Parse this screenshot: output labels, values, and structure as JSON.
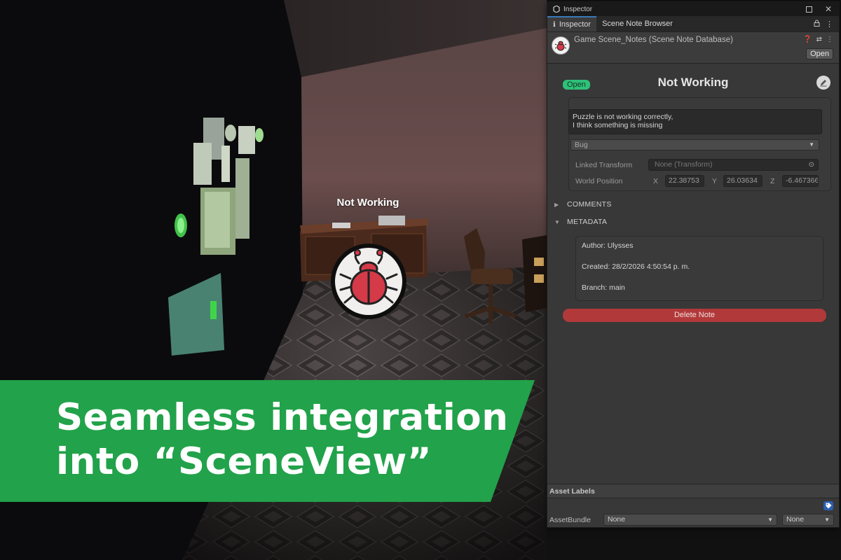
{
  "scene": {
    "note_label": "Not Working"
  },
  "banner": {
    "line1": "Seamless integration",
    "line2": "into “SceneView”",
    "color": "#22a24a"
  },
  "inspector": {
    "window_title": "Inspector",
    "tabs": [
      {
        "label": "Inspector",
        "active": true
      },
      {
        "label": "Scene Note Browser",
        "active": false
      }
    ],
    "asset_title": "Game Scene_Notes (Scene Note Database)",
    "open_button": "Open",
    "note": {
      "status": "Open",
      "status_color": "#2fc07a",
      "title": "Not Working",
      "description_line1": "Puzzle is not working correctly,",
      "description_line2": "I think something is missing",
      "type": "Bug",
      "linked_transform_label": "Linked Transform",
      "linked_transform_value": "None (Transform)",
      "world_position_label": "World Position",
      "x_label": "X",
      "x_value": "22.38753",
      "y_label": "Y",
      "y_value": "26.03634",
      "z_label": "Z",
      "z_value": "-6.467366"
    },
    "comments_label": "COMMENTS",
    "metadata_label": "METADATA",
    "metadata": {
      "author": "Author: Ulysses",
      "created": "Created: 28/2/2026 4:50:54 p. m.",
      "branch": "Branch: main"
    },
    "delete_button": "Delete Note",
    "delete_color": "#b2393a",
    "asset_labels": "Asset Labels",
    "asset_bundle_label": "AssetBundle",
    "asset_bundle_value": "None",
    "asset_variant_value": "None"
  }
}
